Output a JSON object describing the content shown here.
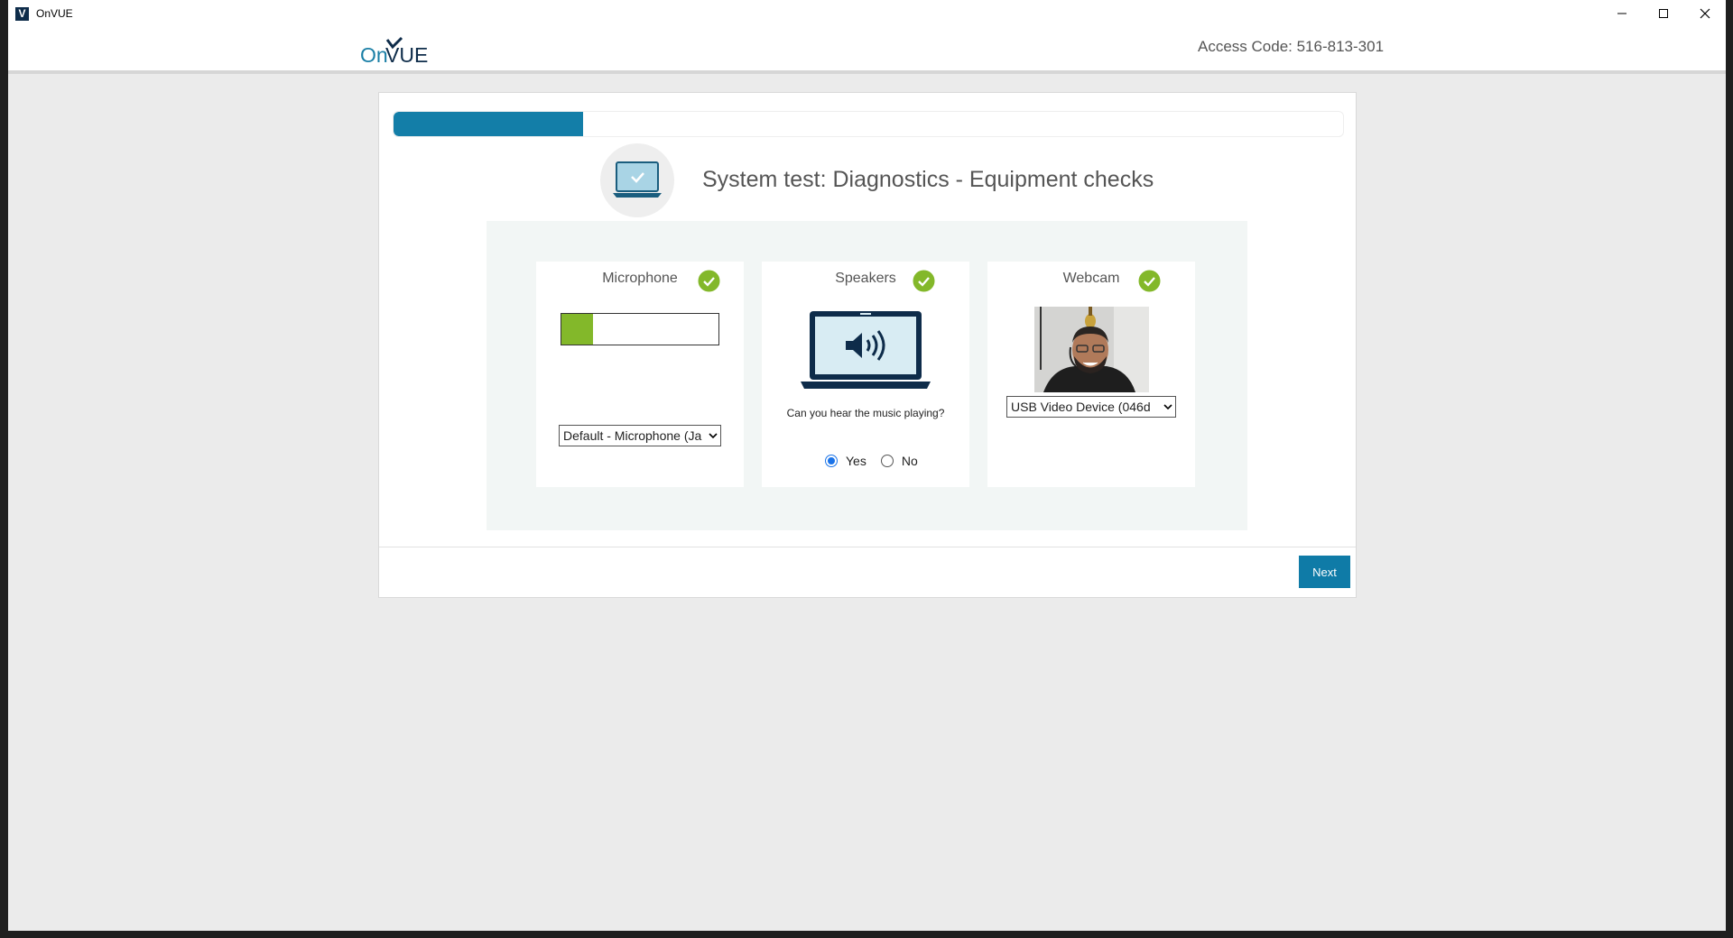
{
  "window": {
    "title": "OnVUE",
    "app_icon_letter": "V"
  },
  "header": {
    "logo_text": "OnVUE",
    "access_code": "Access Code: 516-813-301"
  },
  "progress": {
    "fraction": 0.2
  },
  "page": {
    "title": "System test: Diagnostics - Equipment checks"
  },
  "microphone": {
    "title": "Microphone",
    "level": 0.2,
    "selected_device": "Default - Microphone (Ja"
  },
  "speakers": {
    "title": "Speakers",
    "question": "Can you hear the music playing?",
    "options": [
      "Yes",
      "No"
    ],
    "selected": "Yes"
  },
  "webcam": {
    "title": "Webcam",
    "selected_device": "USB Video Device (046d"
  },
  "actions": {
    "next_label": "Next"
  },
  "colors": {
    "accent": "#137ea8",
    "success": "#83b82a",
    "button": "#0f7ba7"
  }
}
